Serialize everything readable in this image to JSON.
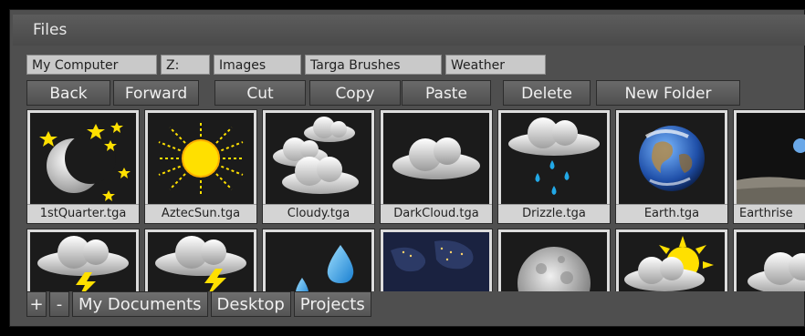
{
  "window": {
    "title": "Files"
  },
  "breadcrumb": [
    "My Computer",
    "Z:",
    "Images",
    "Targa Brushes",
    "Weather"
  ],
  "toolbar": {
    "back": "Back",
    "forward": "Forward",
    "cut": "Cut",
    "copy": "Copy",
    "paste": "Paste",
    "delete": "Delete",
    "new_folder": "New Folder"
  },
  "files": [
    {
      "name": "1stQuarter.tga",
      "icon": "moon-stars-icon"
    },
    {
      "name": "AztecSun.tga",
      "icon": "sun-icon"
    },
    {
      "name": "Cloudy.tga",
      "icon": "clouds-icon"
    },
    {
      "name": "DarkCloud.tga",
      "icon": "cloud-icon"
    },
    {
      "name": "Drizzle.tga",
      "icon": "drizzle-icon"
    },
    {
      "name": "Earth.tga",
      "icon": "earth-icon"
    },
    {
      "name": "Earthrise",
      "icon": "earthrise-icon"
    },
    {
      "name": "",
      "icon": "thunderstorm-icon"
    },
    {
      "name": "",
      "icon": "thunderstorm-icon"
    },
    {
      "name": "",
      "icon": "raindrops-icon"
    },
    {
      "name": "",
      "icon": "night-earth-icon"
    },
    {
      "name": "",
      "icon": "full-moon-icon"
    },
    {
      "name": "",
      "icon": "sun-cloud-icon"
    },
    {
      "name": "",
      "icon": "cloud-icon"
    }
  ],
  "bottom_bar": {
    "add": "+",
    "remove": "-",
    "tabs": [
      "My Documents",
      "Desktop",
      "Projects"
    ]
  },
  "colors": {
    "panel": "#4f4f4f",
    "thumb_bg": "#1b1b1b",
    "caption_bg": "#d4d4d4",
    "sun": "#ffe000",
    "rain": "#22a8e6"
  }
}
